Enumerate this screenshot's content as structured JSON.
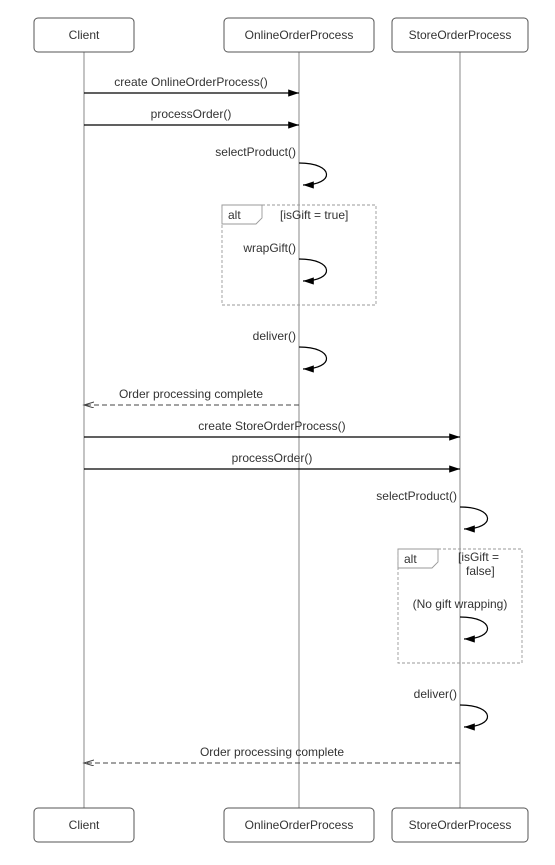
{
  "chart_data": {
    "type": "sequence-diagram",
    "participants": [
      "Client",
      "OnlineOrderProcess",
      "StoreOrderProcess"
    ],
    "messages": [
      {
        "from": "Client",
        "to": "OnlineOrderProcess",
        "label": "create OnlineOrderProcess()",
        "kind": "sync"
      },
      {
        "from": "Client",
        "to": "OnlineOrderProcess",
        "label": "processOrder()",
        "kind": "sync"
      },
      {
        "from": "OnlineOrderProcess",
        "to": "OnlineOrderProcess",
        "label": "selectProduct()",
        "kind": "self"
      },
      {
        "from": "OnlineOrderProcess",
        "to": "OnlineOrderProcess",
        "label": "wrapGift()",
        "kind": "self",
        "fragment": "alt",
        "guard": "isGift = true"
      },
      {
        "from": "OnlineOrderProcess",
        "to": "OnlineOrderProcess",
        "label": "deliver()",
        "kind": "self"
      },
      {
        "from": "OnlineOrderProcess",
        "to": "Client",
        "label": "Order processing complete",
        "kind": "return"
      },
      {
        "from": "Client",
        "to": "StoreOrderProcess",
        "label": "create StoreOrderProcess()",
        "kind": "sync"
      },
      {
        "from": "Client",
        "to": "StoreOrderProcess",
        "label": "processOrder()",
        "kind": "sync"
      },
      {
        "from": "StoreOrderProcess",
        "to": "StoreOrderProcess",
        "label": "selectProduct()",
        "kind": "self"
      },
      {
        "from": "StoreOrderProcess",
        "to": "StoreOrderProcess",
        "label": "(No gift wrapping)",
        "kind": "self",
        "fragment": "alt",
        "guard": "isGift = false"
      },
      {
        "from": "StoreOrderProcess",
        "to": "StoreOrderProcess",
        "label": "deliver()",
        "kind": "self"
      },
      {
        "from": "StoreOrderProcess",
        "to": "Client",
        "label": "Order processing complete",
        "kind": "return"
      }
    ]
  },
  "participants": {
    "client": "Client",
    "online": "OnlineOrderProcess",
    "store": "StoreOrderProcess"
  },
  "msg": {
    "m1": "create OnlineOrderProcess()",
    "m2": "processOrder()",
    "m3": "selectProduct()",
    "m4": "wrapGift()",
    "m5": "deliver()",
    "m6": "Order processing complete",
    "m7": "create StoreOrderProcess()",
    "m8": "processOrder()",
    "m9": "selectProduct()",
    "m10": "(No gift wrapping)",
    "m11": "deliver()",
    "m12": "Order processing complete"
  },
  "alt": {
    "label": "alt",
    "guard1a": "[isGift = true]",
    "guard2a": "[isGift =",
    "guard2b": "false]"
  }
}
